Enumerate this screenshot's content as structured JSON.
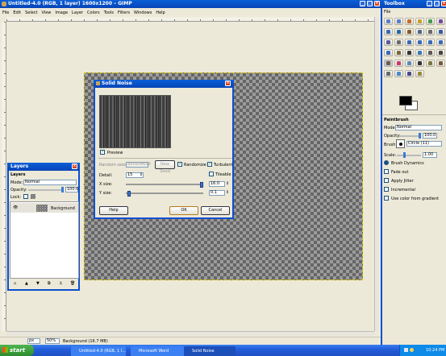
{
  "main_window": {
    "title": "Untitled-4.0 (RGB, 1 layer) 1600x1200 – GIMP",
    "menus": [
      "File",
      "Edit",
      "Select",
      "View",
      "Image",
      "Layer",
      "Colors",
      "Tools",
      "Filters",
      "Windows",
      "Help"
    ],
    "status": {
      "unit": "px",
      "zoom": "50%",
      "info": "Background (16.7 MB)"
    }
  },
  "dialog": {
    "title": "Solid Noise",
    "preview_label": "Preview",
    "random_seed_label": "Random seed:",
    "random_seed_value": "885604659",
    "new_seed_label": "New Seed",
    "randomize_label": "Randomize",
    "turbulent_label": "Turbulent",
    "detail_label": "Detail:",
    "detail_value": "15",
    "tileable_label": "Tileable",
    "xsize_label": "X size:",
    "xsize_value": "16.0",
    "ysize_label": "Y size:",
    "ysize_value": "0.1",
    "help_label": "Help",
    "ok_label": "OK",
    "cancel_label": "Cancel",
    "checks": {
      "preview": true,
      "randomize": true,
      "turbulent": true,
      "tileable": false
    },
    "xsize_level": 1.0,
    "ysize_level": 0.006
  },
  "layers": {
    "title": "Layers",
    "subtitle": "Layers",
    "mode_label": "Mode:",
    "mode_value": "Normal",
    "opacity_label": "Opacity:",
    "opacity_value": "100.0",
    "lock_label": "Lock:",
    "layer_name": "Background"
  },
  "toolbox": {
    "title": "Toolbox",
    "options_title": "Paintbrush",
    "mode_label": "Mode:",
    "mode_value": "Normal",
    "opacity_label": "Opacity:",
    "opacity_value": "100.0",
    "brush_label": "Brush:",
    "brush_value": "Circle (11)",
    "scale_label": "Scale:",
    "scale_value": "1.00",
    "options": [
      "Brush Dynamics",
      "Fade out",
      "Apply Jitter",
      "Incremental",
      "Use color from gradient"
    ]
  },
  "taskbar": {
    "start_label": "start",
    "tasks": [
      "Untitled-4.0 (RGB, 1 l...",
      "Microsoft Word",
      "Solid Noise"
    ],
    "clock": "10:24 PM"
  },
  "colors": {
    "xp_blue": "#0a5fd8",
    "taskbar": "#245edb",
    "start": "#3c9a3c",
    "canvas_bg": "#ece9d8"
  }
}
